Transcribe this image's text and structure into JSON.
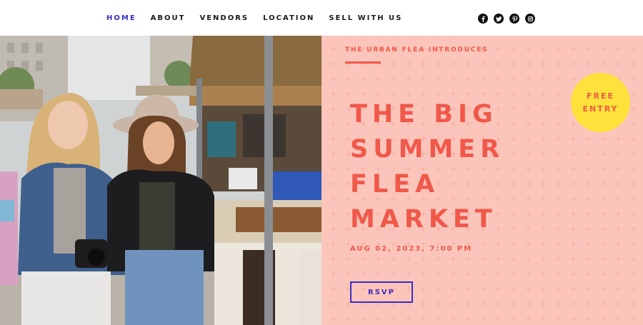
{
  "nav": {
    "items": [
      {
        "label": "HOME",
        "active": true
      },
      {
        "label": "ABOUT",
        "active": false
      },
      {
        "label": "VENDORS",
        "active": false
      },
      {
        "label": "LOCATION",
        "active": false
      },
      {
        "label": "SELL WITH US",
        "active": false
      }
    ]
  },
  "social": [
    "facebook-icon",
    "twitter-icon",
    "pinterest-icon",
    "instagram-icon"
  ],
  "hero": {
    "kicker": "THE URBAN FLEA INTRODUCES",
    "headline": [
      "THE BIG",
      "SUMMER",
      "FLEA",
      "MARKET"
    ],
    "date": "AUG 02, 2023, 7:00 PM",
    "rsvp_label": "RSVP",
    "badge": [
      "FREE",
      "ENTRY"
    ]
  },
  "colors": {
    "accent": "#f0584a",
    "nav_active": "#3b2fc0",
    "panel_bg": "#fbc5bb",
    "badge_bg": "#fce23a"
  }
}
